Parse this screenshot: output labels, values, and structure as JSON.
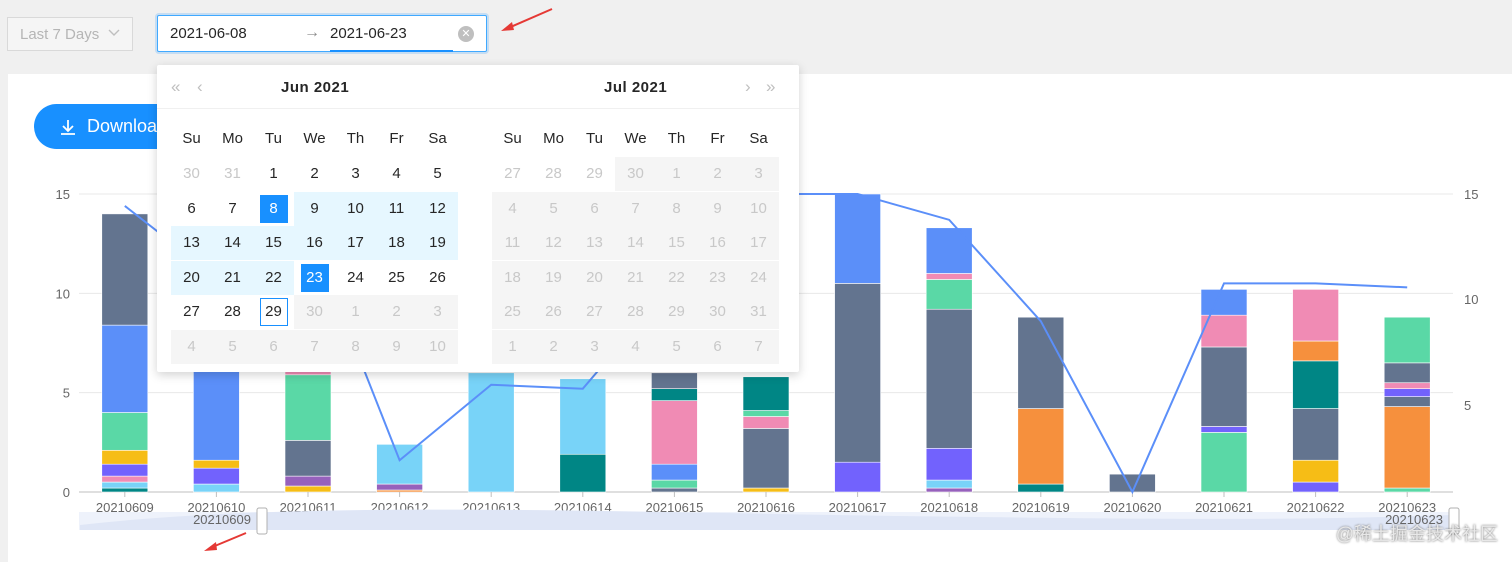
{
  "preset": {
    "label": "Last 7 Days"
  },
  "range": {
    "start": "2021-06-08",
    "arrow": "→",
    "end": "2021-06-23"
  },
  "download": {
    "label": "Download"
  },
  "watermark": "@稀土掘金技术社区",
  "calendar": {
    "weekdays": [
      "Su",
      "Mo",
      "Tu",
      "We",
      "Th",
      "Fr",
      "Sa"
    ],
    "left": {
      "title": "Jun  2021",
      "weeks": [
        [
          "30",
          "31",
          "1",
          "2",
          "3",
          "4",
          "5"
        ],
        [
          "6",
          "7",
          "8",
          "9",
          "10",
          "11",
          "12"
        ],
        [
          "13",
          "14",
          "15",
          "16",
          "17",
          "18",
          "19"
        ],
        [
          "20",
          "21",
          "22",
          "23",
          "24",
          "25",
          "26"
        ],
        [
          "27",
          "28",
          "29",
          "30",
          "1",
          "2",
          "3"
        ],
        [
          "4",
          "5",
          "6",
          "7",
          "8",
          "9",
          "10"
        ]
      ],
      "states": [
        [
          "out",
          "out",
          "norm",
          "norm",
          "norm",
          "norm",
          "norm"
        ],
        [
          "norm",
          "norm",
          "sel",
          "inr",
          "inr",
          "inr",
          "inr"
        ],
        [
          "inr",
          "inr",
          "inr",
          "inr",
          "inr",
          "inr",
          "inr"
        ],
        [
          "inr",
          "inr",
          "inr",
          "sel",
          "norm",
          "norm",
          "norm"
        ],
        [
          "norm",
          "norm",
          "today",
          "dis",
          "dis",
          "dis",
          "dis"
        ],
        [
          "dis",
          "dis",
          "dis",
          "dis",
          "dis",
          "dis",
          "dis"
        ]
      ]
    },
    "right": {
      "title": "Jul  2021",
      "weeks": [
        [
          "27",
          "28",
          "29",
          "30",
          "1",
          "2",
          "3"
        ],
        [
          "4",
          "5",
          "6",
          "7",
          "8",
          "9",
          "10"
        ],
        [
          "11",
          "12",
          "13",
          "14",
          "15",
          "16",
          "17"
        ],
        [
          "18",
          "19",
          "20",
          "21",
          "22",
          "23",
          "24"
        ],
        [
          "25",
          "26",
          "27",
          "28",
          "29",
          "30",
          "31"
        ],
        [
          "1",
          "2",
          "3",
          "4",
          "5",
          "6",
          "7"
        ]
      ],
      "states": [
        [
          "out",
          "out",
          "out",
          "dis",
          "dis",
          "dis",
          "dis"
        ],
        [
          "dis",
          "dis",
          "dis",
          "dis",
          "dis",
          "dis",
          "dis"
        ],
        [
          "dis",
          "dis",
          "dis",
          "dis",
          "dis",
          "dis",
          "dis"
        ],
        [
          "dis",
          "dis",
          "dis",
          "dis",
          "dis",
          "dis",
          "dis"
        ],
        [
          "dis",
          "dis",
          "dis",
          "dis",
          "dis",
          "dis",
          "dis"
        ],
        [
          "dis",
          "dis",
          "dis",
          "dis",
          "dis",
          "dis",
          "dis"
        ]
      ]
    }
  },
  "chart_data": {
    "type": "bar",
    "stacked": true,
    "categories": [
      "20210609",
      "20210610",
      "20210611",
      "20210612",
      "20210613",
      "20210614",
      "20210615",
      "20210616",
      "20210617",
      "20210618",
      "20210619",
      "20210620",
      "20210621",
      "20210622",
      "20210623"
    ],
    "yticks": [
      0,
      5,
      10,
      15
    ],
    "ylim": [
      0,
      15
    ],
    "right_yticks": [
      "5",
      "10",
      "15"
    ],
    "stack_colors": [
      "#5b8ff9",
      "#63748f",
      "#5ad8a6",
      "#f6bd16",
      "#7262fd",
      "#78d3f8",
      "#9661bc",
      "#f6903d",
      "#008685",
      "#f08bb4"
    ],
    "stacks": [
      [
        {
          "c": 8,
          "v": 0.2
        },
        {
          "c": 5,
          "v": 0.3
        },
        {
          "c": 9,
          "v": 0.3
        },
        {
          "c": 4,
          "v": 0.6
        },
        {
          "c": 3,
          "v": 0.7
        },
        {
          "c": 2,
          "v": 1.9
        },
        {
          "c": 0,
          "v": 4.4
        },
        {
          "c": 1,
          "v": 5.6
        }
      ],
      [
        {
          "c": 5,
          "v": 0.4
        },
        {
          "c": 4,
          "v": 0.8
        },
        {
          "c": 3,
          "v": 0.4
        },
        {
          "c": 0,
          "v": 5.1
        }
      ],
      [
        {
          "c": 3,
          "v": 0.3
        },
        {
          "c": 6,
          "v": 0.5
        },
        {
          "c": 1,
          "v": 1.8
        },
        {
          "c": 2,
          "v": 3.3
        },
        {
          "c": 9,
          "v": 0.2
        }
      ],
      [
        {
          "c": 7,
          "v": 0.1
        },
        {
          "c": 6,
          "v": 0.3
        },
        {
          "c": 5,
          "v": 2.0
        }
      ],
      [
        {
          "c": 5,
          "v": 6.0
        }
      ],
      [
        {
          "c": 8,
          "v": 1.9
        },
        {
          "c": 5,
          "v": 3.8
        }
      ],
      [
        {
          "c": 1,
          "v": 0.2
        },
        {
          "c": 2,
          "v": 0.4
        },
        {
          "c": 0,
          "v": 0.8
        },
        {
          "c": 9,
          "v": 3.2
        },
        {
          "c": 8,
          "v": 0.6
        },
        {
          "c": 1,
          "v": 0.8
        }
      ],
      [
        {
          "c": 3,
          "v": 0.2
        },
        {
          "c": 1,
          "v": 3.0
        },
        {
          "c": 9,
          "v": 0.6
        },
        {
          "c": 2,
          "v": 0.3
        },
        {
          "c": 8,
          "v": 1.7
        }
      ],
      [
        {
          "c": 4,
          "v": 1.5
        },
        {
          "c": 1,
          "v": 9.0
        },
        {
          "c": 0,
          "v": 4.5
        }
      ],
      [
        {
          "c": 6,
          "v": 0.2
        },
        {
          "c": 5,
          "v": 0.4
        },
        {
          "c": 4,
          "v": 1.6
        },
        {
          "c": 1,
          "v": 7.0
        },
        {
          "c": 2,
          "v": 1.5
        },
        {
          "c": 9,
          "v": 0.3
        },
        {
          "c": 0,
          "v": 2.3
        }
      ],
      [
        {
          "c": 8,
          "v": 0.4
        },
        {
          "c": 7,
          "v": 3.8
        },
        {
          "c": 1,
          "v": 4.6
        }
      ],
      [
        {
          "c": 1,
          "v": 0.9
        }
      ],
      [
        {
          "c": 2,
          "v": 3.0
        },
        {
          "c": 4,
          "v": 0.3
        },
        {
          "c": 1,
          "v": 4.0
        },
        {
          "c": 9,
          "v": 1.6
        },
        {
          "c": 0,
          "v": 1.3
        }
      ],
      [
        {
          "c": 4,
          "v": 0.5
        },
        {
          "c": 3,
          "v": 1.1
        },
        {
          "c": 1,
          "v": 2.6
        },
        {
          "c": 8,
          "v": 2.4
        },
        {
          "c": 7,
          "v": 1.0
        },
        {
          "c": 9,
          "v": 2.6
        }
      ],
      [
        {
          "c": 2,
          "v": 0.2
        },
        {
          "c": 7,
          "v": 4.1
        },
        {
          "c": 1,
          "v": 0.5
        },
        {
          "c": 4,
          "v": 0.4
        },
        {
          "c": 9,
          "v": 0.3
        },
        {
          "c": 1,
          "v": 1.0
        },
        {
          "c": 2,
          "v": 2.3
        }
      ]
    ],
    "line": [
      14.4,
      10.8,
      13.3,
      1.6,
      5.4,
      5.2,
      10.6,
      15.0,
      15.0,
      13.7,
      8.6,
      0.0,
      10.5,
      10.5,
      10.3
    ],
    "slider": {
      "start_label": "20210609",
      "end_label": "20210623"
    }
  }
}
